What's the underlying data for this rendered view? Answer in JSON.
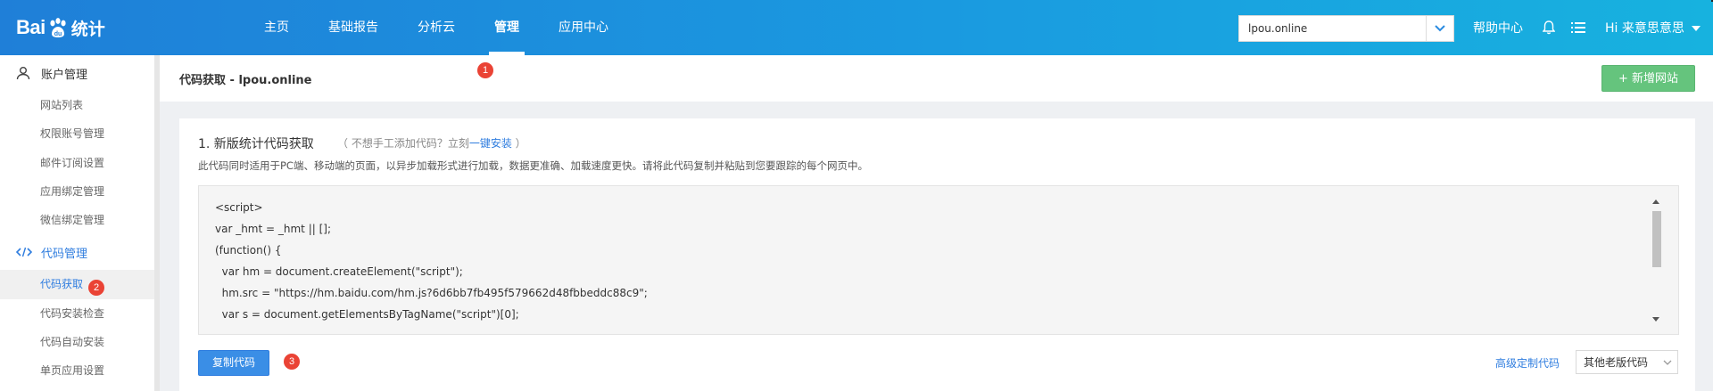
{
  "logo": {
    "text_bai": "Bai",
    "text_tongji": "统计"
  },
  "nav": {
    "items": [
      {
        "label": "主页"
      },
      {
        "label": "基础报告"
      },
      {
        "label": "分析云"
      },
      {
        "label": "管理"
      },
      {
        "label": "应用中心"
      }
    ],
    "active_index": 3
  },
  "site_select": {
    "value": "lpou.online"
  },
  "toplinks": {
    "help": "帮助中心",
    "user": "Hi  来意思意思"
  },
  "sidebar": {
    "groups": [
      {
        "label": "账户管理",
        "icon": "user-icon",
        "items": [
          "网站列表",
          "权限账号管理",
          "邮件订阅设置",
          "应用绑定管理",
          "微信绑定管理"
        ]
      },
      {
        "label": "代码管理",
        "icon": "code-icon",
        "items": [
          "代码获取",
          "代码安装检查",
          "代码自动安装",
          "单页应用设置"
        ]
      }
    ]
  },
  "header": {
    "title": "代码获取 - lpou.online",
    "add_site_label": "新增网站"
  },
  "section": {
    "title": "1. 新版统计代码获取",
    "hint_prefix": "（ 不想手工添加代码？立刻",
    "hint_link": "一键安装",
    "hint_suffix": " ）",
    "desc": "此代码同时适用于PC端、移动端的页面，以异步加载形式进行加载，数据更准确、加载速度更快。请将此代码复制并粘贴到您要跟踪的每个网页中。"
  },
  "code_lines": [
    "<script>",
    "var _hmt = _hmt || [];",
    "(function() {",
    "  var hm = document.createElement(\"script\");",
    "  hm.src = \"https://hm.baidu.com/hm.js?6d6bb7fb495f579662d48fbbeddc88c9\";",
    "  var s = document.getElementsByTagName(\"script\")[0];"
  ],
  "footer": {
    "copy_label": "复制代码",
    "advanced_link": "高级定制代码",
    "old_code_select": "其他老版代码"
  },
  "badges": [
    "1",
    "2",
    "3"
  ],
  "colors": {
    "topbar_start": "#1f7fd8",
    "topbar_end": "#17b2df",
    "accent": "#2f7ddf",
    "add_button": "#65c47d",
    "badge": "#ea4335"
  }
}
